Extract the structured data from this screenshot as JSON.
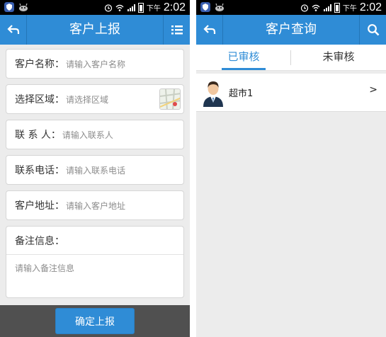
{
  "status_bar": {
    "ampm": "下午",
    "time": "2:02"
  },
  "report_screen": {
    "title": "客户上报",
    "fields": [
      {
        "label": "客户名称：",
        "placeholder": "请输入客户名称"
      },
      {
        "label": "选择区域：",
        "placeholder": "请选择区域"
      },
      {
        "label": "联 系 人：",
        "placeholder": "请输入联系人"
      },
      {
        "label": "联系电话：",
        "placeholder": "请输入联系电话"
      },
      {
        "label": "客户地址：",
        "placeholder": "请输入客户地址"
      }
    ],
    "notes": {
      "label": "备注信息：",
      "placeholder": "请输入备注信息"
    },
    "submit_label": "确定上报"
  },
  "query_screen": {
    "title": "客户查询",
    "tabs": [
      {
        "label": "已审核",
        "active": true
      },
      {
        "label": "未审核",
        "active": false
      }
    ],
    "items": [
      {
        "name": "超市1",
        "chevron": ">"
      }
    ]
  },
  "colors": {
    "primary": "#2f8cd6",
    "status_bar": "#000000",
    "bottom_bar": "#505050",
    "background": "#ececec"
  }
}
